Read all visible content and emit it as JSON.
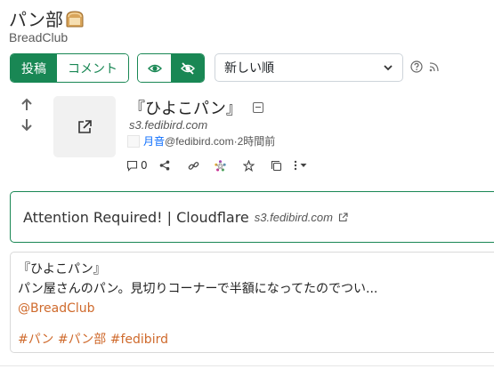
{
  "community": {
    "title": "パン部",
    "title_icon": "bread-emoji",
    "subtitle": "BreadClub"
  },
  "listing_tabs": {
    "posts_label": "投稿",
    "comments_label": "コメント",
    "active": "posts"
  },
  "view_toggle": {
    "icons": [
      "eye-icon",
      "eye-slash-icon"
    ],
    "active": "eye-slash-icon"
  },
  "sort": {
    "selected": "新しい順"
  },
  "post": {
    "title": "『ひよこパン』",
    "domain": "s3.fedibird.com",
    "author": "月音",
    "author_host": "@fedibird.com",
    "separator": " · ",
    "time_ago": "2時間前",
    "comment_count": "0"
  },
  "link_card": {
    "title": "Attention Required! | Cloudflare",
    "domain": "s3.fedibird.com"
  },
  "body": {
    "line1": "『ひよこパン』",
    "line2": "パン屋さんのパン。見切りコーナーで半額になってたのでつい...",
    "mention": "@BreadClub",
    "tags": "#パン #パン部 #fedibird"
  },
  "colors": {
    "accent": "#198754",
    "link": "#0d6efd",
    "tag": "#cf6a2c"
  }
}
